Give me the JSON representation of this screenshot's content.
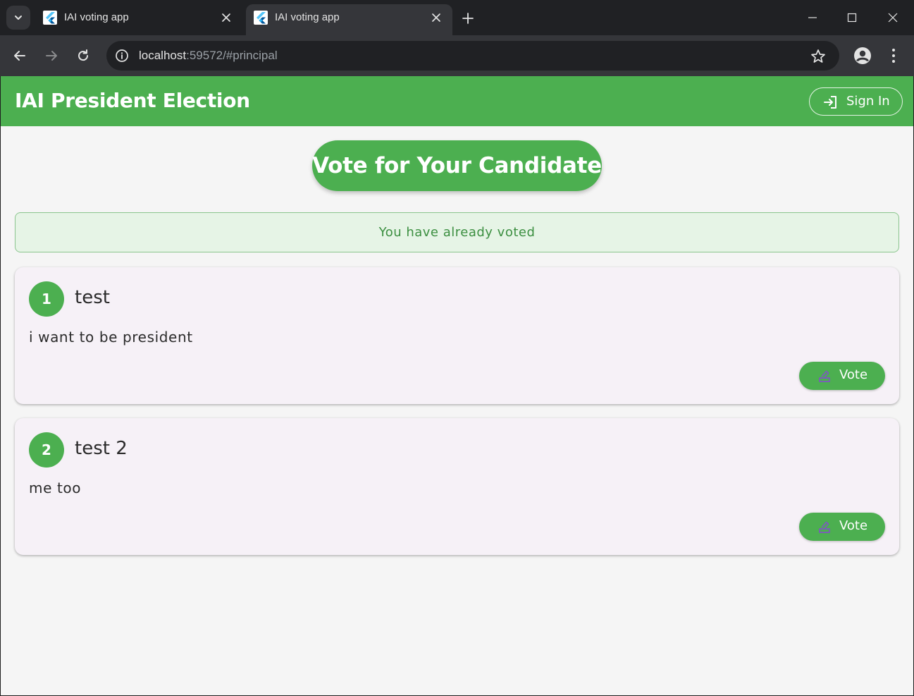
{
  "browser": {
    "tabs": [
      {
        "title": "IAI voting app",
        "active": false
      },
      {
        "title": "IAI voting app",
        "active": true
      }
    ],
    "url_host": "localhost",
    "url_path": ":59572/#principal"
  },
  "app": {
    "title": "IAI President Election",
    "sign_in_label": "Sign In",
    "headline": "Vote for Your Candidate",
    "notice": "You have already voted"
  },
  "candidates": [
    {
      "number": "1",
      "name": "test",
      "description": "i want to be president",
      "vote_label": "Vote"
    },
    {
      "number": "2",
      "name": "test 2",
      "description": "me too",
      "vote_label": "Vote"
    }
  ],
  "colors": {
    "primary": "#4caf50",
    "card_bg": "#f6f1f7",
    "notice_bg": "#e6f4e6",
    "notice_text": "#3c8f41",
    "vote_icon": "#7e57c2"
  },
  "icons": {
    "tab_search": "chevron-down-icon",
    "favicon": "flutter-icon",
    "tab_close": "close-icon",
    "new_tab": "plus-icon",
    "back": "arrow-left-icon",
    "forward": "arrow-right-icon",
    "reload": "reload-icon",
    "site_info": "info-icon",
    "bookmark": "star-icon",
    "profile": "person-icon",
    "menu": "kebab-icon",
    "sign_in": "login-icon",
    "vote": "ballot-icon"
  }
}
